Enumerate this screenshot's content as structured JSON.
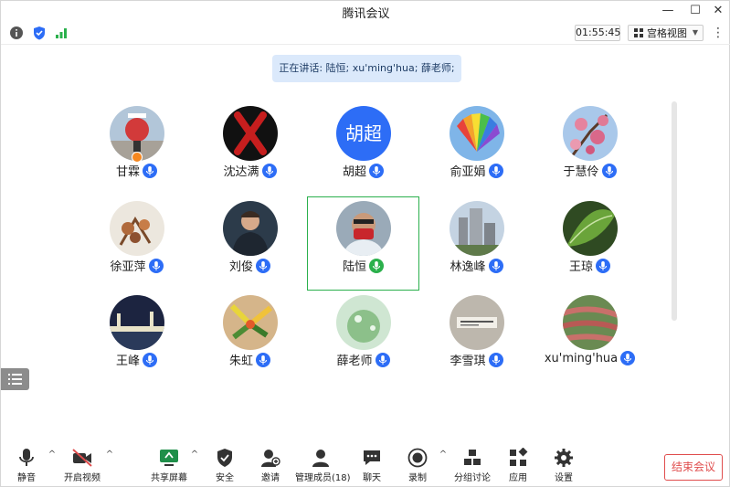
{
  "window": {
    "title": "腾讯会议"
  },
  "toolbar": {
    "timer": "01:55:45",
    "view_label": "宫格视图"
  },
  "speaking": {
    "text": "正在讲话: 陆恒; xu'ming'hua; 薛老师;"
  },
  "participants": [
    {
      "name": "甘霖",
      "mic_color": "#2d6df6"
    },
    {
      "name": "沈达满",
      "mic_color": "#2d6df6"
    },
    {
      "name": "胡超",
      "avatar_text": "胡超",
      "mic_color": "#2d6df6"
    },
    {
      "name": "俞亚娟",
      "mic_color": "#2d6df6"
    },
    {
      "name": "于慧伶",
      "mic_color": "#2d6df6"
    },
    {
      "name": "徐亚萍",
      "mic_color": "#2d6df6"
    },
    {
      "name": "刘俊",
      "mic_color": "#2d6df6"
    },
    {
      "name": "陆恒",
      "mic_color": "#2bb04c",
      "active": true
    },
    {
      "name": "林逸峰",
      "mic_color": "#2d6df6"
    },
    {
      "name": "王琼",
      "mic_color": "#2d6df6"
    },
    {
      "name": "王峰",
      "mic_color": "#2d6df6"
    },
    {
      "name": "朱虹",
      "mic_color": "#2d6df6"
    },
    {
      "name": "薛老师",
      "mic_color": "#2d6df6"
    },
    {
      "name": "李雪琪",
      "mic_color": "#2d6df6"
    },
    {
      "name": "xu'ming'hua",
      "mic_color": "#2d6df6"
    }
  ],
  "bottom": {
    "mute": "静音",
    "video": "开启视频",
    "share": "共享屏幕",
    "security": "安全",
    "invite": "邀请",
    "members": "管理成员(18)",
    "chat": "聊天",
    "record": "录制",
    "breakout": "分组讨论",
    "apps": "应用",
    "settings": "设置",
    "end": "结束会议"
  },
  "colors": {
    "accent": "#2d6df6",
    "active_border": "#2bb04c",
    "end": "#e04d4d"
  }
}
